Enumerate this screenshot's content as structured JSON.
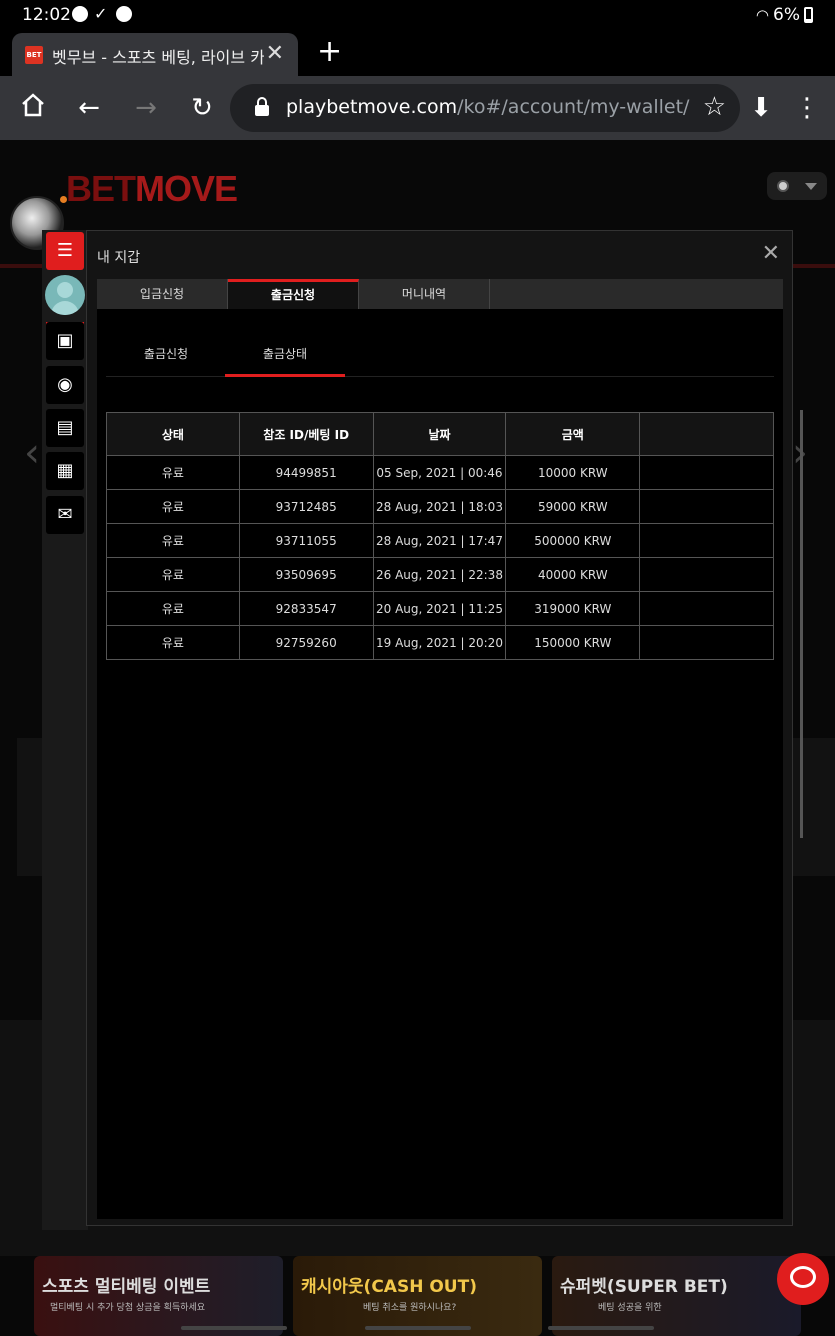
{
  "status_bar": {
    "time": "12:02",
    "battery": "6%"
  },
  "browser": {
    "tab_title": "벳무브 - 스포츠 베팅, 라이브 카",
    "favicon_text": "BET",
    "url_domain": "playbetmove.com",
    "url_path": "/ko#/account/my-wallet/witho"
  },
  "site": {
    "logo_part1": "BET",
    "logo_part2": "MOVE"
  },
  "modal": {
    "title": "내 지갑",
    "tabs": [
      "입금신청",
      "출금신청",
      "머니내역"
    ],
    "active_tab": "출금신청",
    "subtabs": [
      "출금신청",
      "출금상태"
    ],
    "active_subtab": "출금상태",
    "table": {
      "headers": [
        "상태",
        "참조 ID/베팅 ID",
        "날짜",
        "금액",
        ""
      ],
      "rows": [
        [
          "유료",
          "94499851",
          "05 Sep, 2021 | 00:46",
          "10000 KRW",
          ""
        ],
        [
          "유료",
          "93712485",
          "28 Aug, 2021 | 18:03",
          "59000 KRW",
          ""
        ],
        [
          "유료",
          "93711055",
          "28 Aug, 2021 | 17:47",
          "500000 KRW",
          ""
        ],
        [
          "유료",
          "93509695",
          "26 Aug, 2021 | 22:38",
          "40000 KRW",
          ""
        ],
        [
          "유료",
          "92833547",
          "20 Aug, 2021 | 11:25",
          "319000 KRW",
          ""
        ],
        [
          "유료",
          "92759260",
          "19 Aug, 2021 | 20:20",
          "150000 KRW",
          ""
        ]
      ]
    }
  },
  "promos": [
    {
      "title": "스포츠 멀티베팅 이벤트",
      "subtitle": "멀티베팅 시 추가 당첨 상금을 획득하세요"
    },
    {
      "title": "캐시아웃(CASH OUT)",
      "subtitle": "베팅 취소를 원하시나요?"
    },
    {
      "title": "슈퍼벳(SUPER BET)",
      "subtitle": "베팅 성공을 위한"
    }
  ],
  "colors": {
    "accent": "#e01e1e",
    "toolbar": "#35363a",
    "modal_bg": "#141414"
  }
}
